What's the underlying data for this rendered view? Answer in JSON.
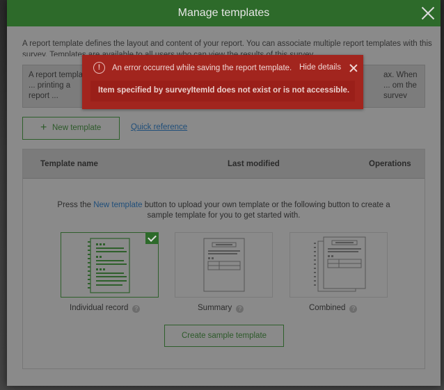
{
  "modal": {
    "title": "Manage templates",
    "intro": "A report template defines the layout and content of your report. You can associate multiple report templates with this survey. Templates are available to all users who can view the results of this survey.",
    "info_left": "A report template ... printing a report ... response. For m...",
    "info_right": "ax. When ... om the survey"
  },
  "error": {
    "message": "An error occurred while saving the report template.",
    "hide_details": "Hide details",
    "detail": "Item specified by surveyItemId does not exist or is not accessible."
  },
  "toolbar": {
    "new_template": "New template",
    "quick_reference": "Quick reference"
  },
  "table": {
    "columns": [
      "Template name",
      "Last modified",
      "Operations"
    ],
    "hint_before": "Press the ",
    "hint_link": "New template",
    "hint_after": " button to upload your own template or the following button to create a sample template for you to get started with."
  },
  "templates": [
    {
      "label": "Individual record",
      "selected": true
    },
    {
      "label": "Summary",
      "selected": false
    },
    {
      "label": "Combined",
      "selected": false
    }
  ],
  "create_button": "Create sample template",
  "icons": {
    "close": "close-icon",
    "error": "error-icon",
    "plus": "plus-icon",
    "help": "help-icon",
    "check": "check-icon"
  },
  "colors": {
    "header": "#2d6a2a",
    "error": "#a2251e",
    "accent": "#2d5a2a"
  }
}
